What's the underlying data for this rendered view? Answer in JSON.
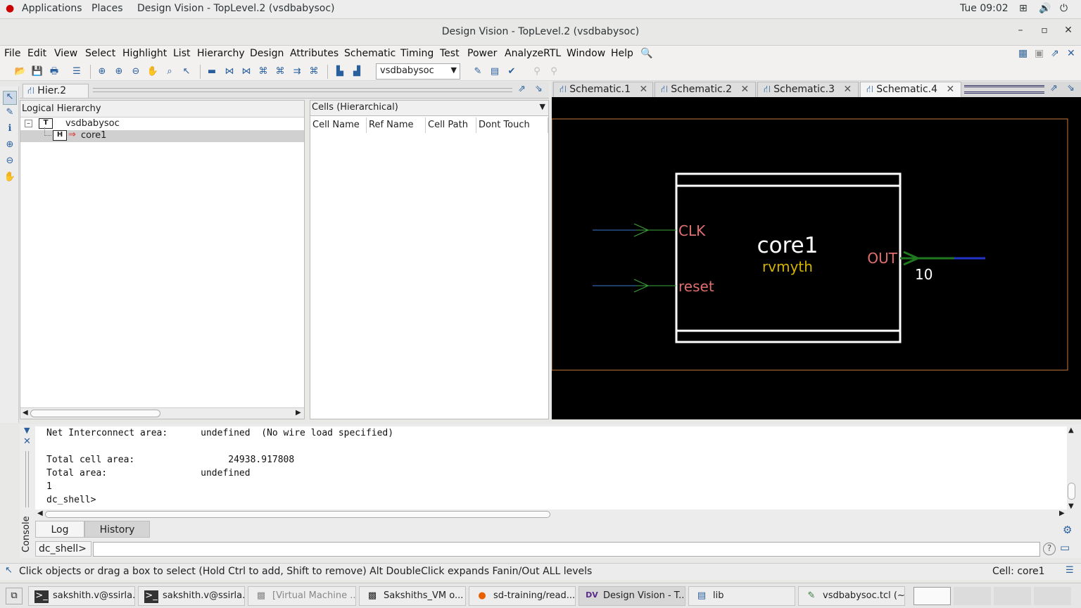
{
  "top_bar": {
    "applications": "Applications",
    "places": "Places",
    "window_title": "Design Vision - TopLevel.2 (vsdbabysoc)",
    "clock": "Tue 09:02"
  },
  "window": {
    "title": "Design Vision - TopLevel.2 (vsdbabysoc)",
    "minimize": "–",
    "maximize": "▫",
    "close": "✕"
  },
  "menu": [
    "File",
    "Edit",
    "View",
    "Select",
    "Highlight",
    "List",
    "Hierarchy",
    "Design",
    "Attributes",
    "Schematic",
    "Timing",
    "Test",
    "Power",
    "AnalyzeRTL",
    "Window",
    "Help"
  ],
  "toolbar": {
    "design_combo": "vsdbabysoc"
  },
  "hier_tab": {
    "label": "Hier.2"
  },
  "hierarchy": {
    "title": "Logical Hierarchy",
    "root": {
      "badge": "T",
      "name": "vsdbabysoc"
    },
    "child": {
      "badge": "H",
      "name": "core1"
    }
  },
  "cells": {
    "dropdown": "Cells (Hierarchical)",
    "columns": [
      "Cell Name",
      "Ref Name",
      "Cell Path",
      "Dont Touch"
    ]
  },
  "schematic_tabs": [
    "Schematic.1",
    "Schematic.2",
    "Schematic.3",
    "Schematic.4"
  ],
  "schematic": {
    "cell_name": "core1",
    "ref_name": "rvmyth",
    "input_pins": [
      "CLK",
      "reset"
    ],
    "output_pin": "OUT",
    "bus_width": "10",
    "colors": {
      "pin": "#e07070",
      "ref": "#d4b400",
      "net_in": "#3aa83a",
      "net_out": "#1f7a1f",
      "bus": "#2233cc",
      "border": "#c8783c"
    }
  },
  "console": {
    "lines": [
      "Net Interconnect area:      undefined  (No wire load specified)",
      "",
      "Total cell area:                 24938.917808",
      "Total area:                 undefined",
      "1",
      "dc_shell>"
    ],
    "tabs": [
      "Log",
      "History"
    ],
    "side_label": "Console",
    "prompt": "dc_shell>"
  },
  "status": {
    "message": "Click objects or drag a box to select (Hold Ctrl to add, Shift to remove) Alt DoubleClick expands Fanin/Out ALL levels",
    "cell": "Cell: core1"
  },
  "taskbar": [
    {
      "label": "sakshith.v@ssirla...",
      "icon": "terminal-icon"
    },
    {
      "label": "sakshith.v@ssirla...",
      "icon": "terminal-icon"
    },
    {
      "label": "[Virtual Machine ...",
      "icon": "vm-icon"
    },
    {
      "label": "Sakshiths_VM o...",
      "icon": "vm-icon"
    },
    {
      "label": "sd-training/read...",
      "icon": "firefox-icon"
    },
    {
      "label": "Design Vision - T...",
      "icon": "dv-icon"
    },
    {
      "label": "lib",
      "icon": "file-manager-icon"
    },
    {
      "label": "vsdbabysoc.tcl (~...",
      "icon": "editor-icon"
    }
  ]
}
